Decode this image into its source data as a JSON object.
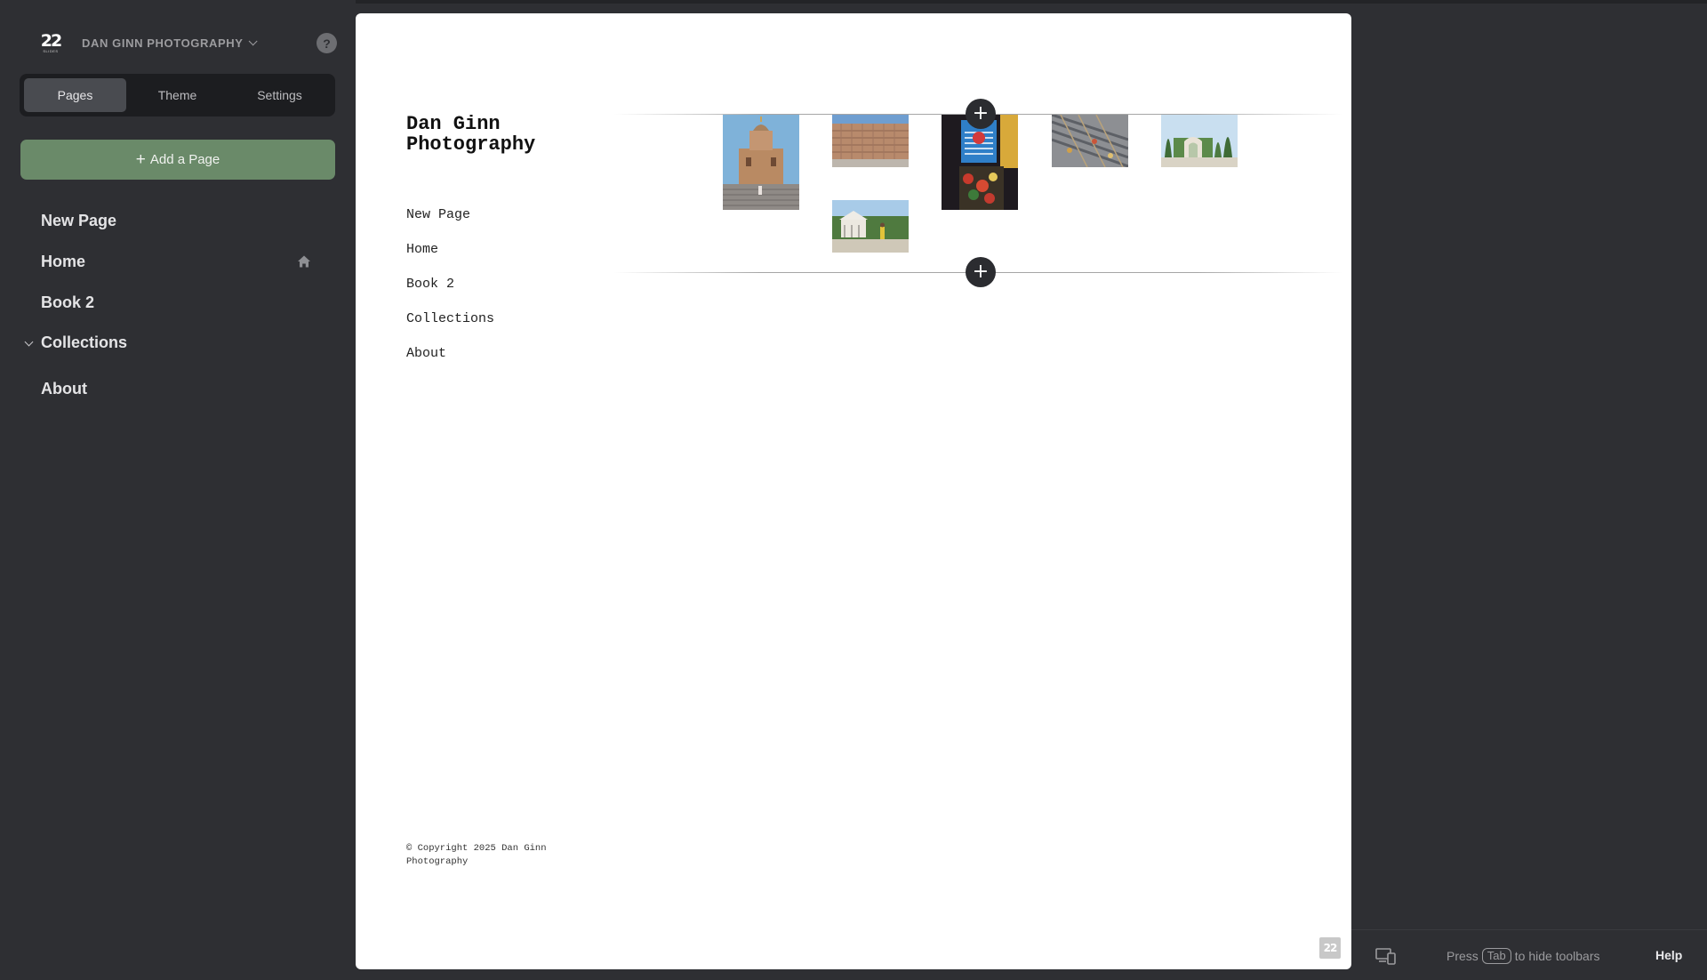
{
  "sidebar": {
    "logo": {
      "number": "22",
      "sub": "SLIDES"
    },
    "site_name": "DAN GINN PHOTOGRAPHY",
    "help_glyph": "?",
    "tabs": [
      {
        "label": "Pages",
        "active": true
      },
      {
        "label": "Theme",
        "active": false
      },
      {
        "label": "Settings",
        "active": false
      }
    ],
    "add_page_label": "Add a Page",
    "add_page_plus": "+",
    "pages": [
      {
        "label": "New Page"
      },
      {
        "label": "Home",
        "icon": "home-icon"
      },
      {
        "label": "Book 2"
      },
      {
        "label": "Collections",
        "icon": "chevron-down-icon"
      },
      {
        "label": "About"
      }
    ]
  },
  "site": {
    "title": "Dan Ginn Photography",
    "nav": [
      "New Page",
      "Home",
      "Book 2",
      "Collections",
      "About"
    ],
    "copyright": "© Copyright 2025 Dan Ginn Photography",
    "add_section_glyph": "+",
    "badge": "22"
  },
  "gallery": {
    "photos": [
      {
        "subject": "cathedral"
      },
      {
        "subject": "building"
      },
      {
        "subject": "shop-sign"
      },
      {
        "subject": "crowd"
      },
      {
        "subject": "garden-arch"
      },
      {
        "subject": "gazebo"
      }
    ]
  },
  "bottombar": {
    "hint_prefix": "Press",
    "hint_key": "Tab",
    "hint_suffix": "to hide toolbars",
    "help": "Help"
  },
  "colors": {
    "app_bg": "#2e2f33",
    "accent_green": "#6a8a69",
    "canvas_bg": "#ffffff"
  }
}
